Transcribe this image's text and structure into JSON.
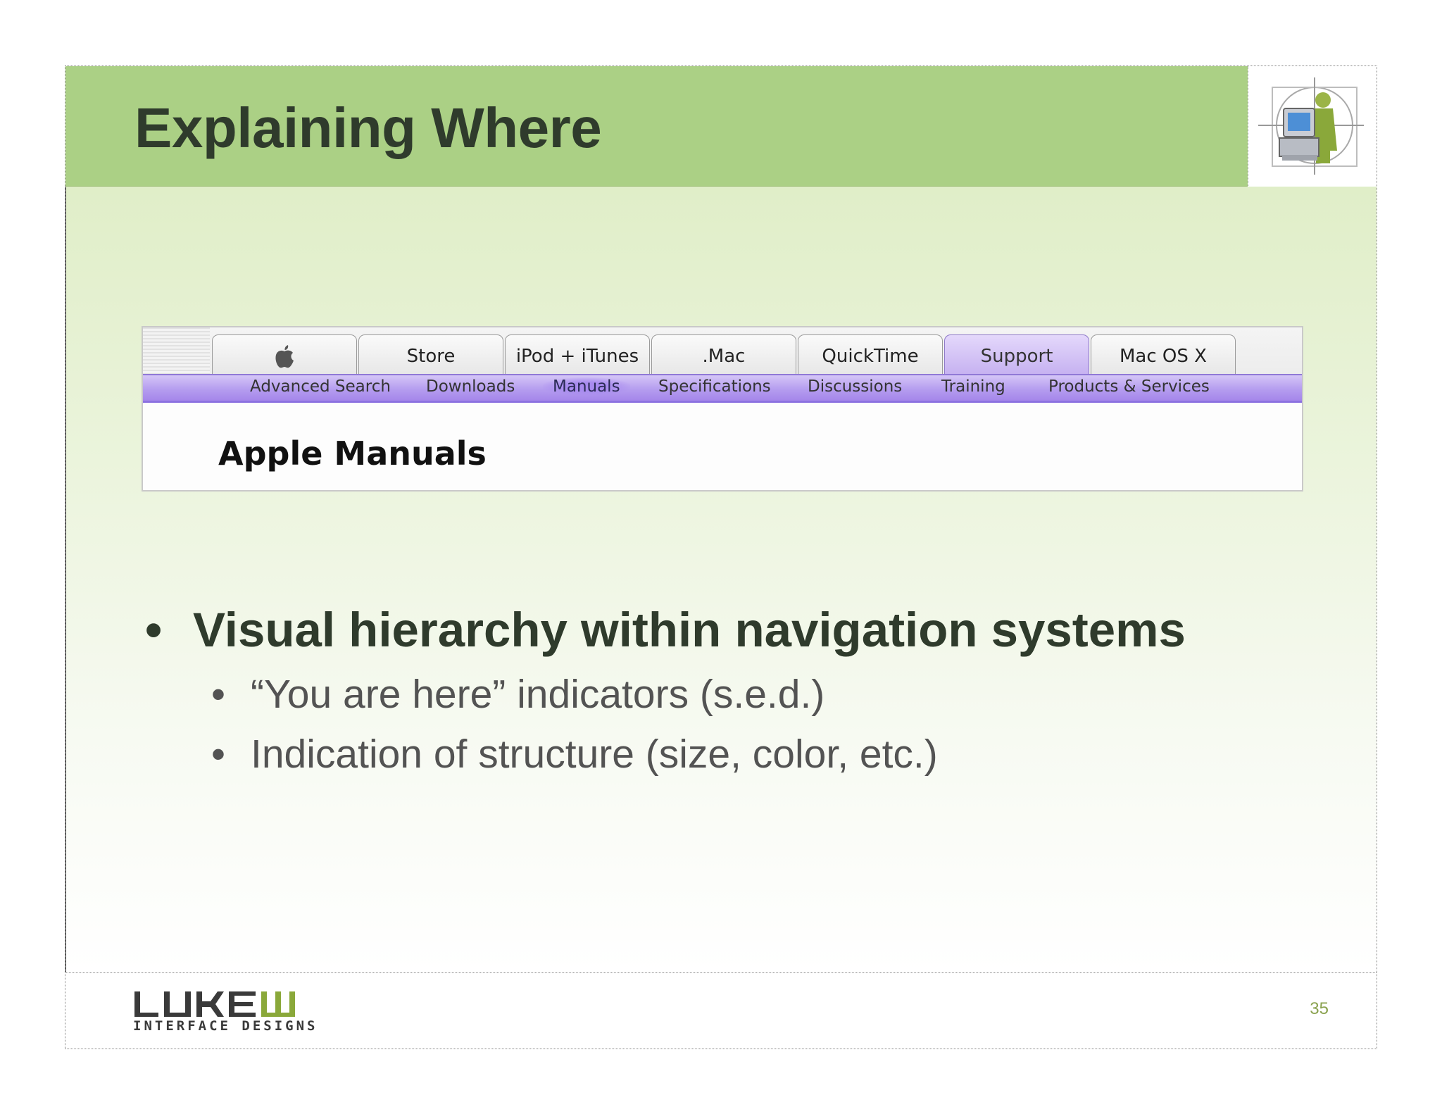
{
  "slide": {
    "title": "Explaining Where",
    "page_number": "35"
  },
  "screenshot": {
    "tabs": [
      {
        "label": "",
        "icon": "apple-logo-icon",
        "active": false
      },
      {
        "label": "Store",
        "active": false
      },
      {
        "label": "iPod + iTunes",
        "active": false
      },
      {
        "label": ".Mac",
        "active": false
      },
      {
        "label": "QuickTime",
        "active": false
      },
      {
        "label": "Support",
        "active": true
      },
      {
        "label": "Mac OS X",
        "active": false
      }
    ],
    "subnav": [
      {
        "label": "Advanced Search",
        "active": false
      },
      {
        "label": "Downloads",
        "active": false
      },
      {
        "label": "Manuals",
        "active": true
      },
      {
        "label": "Specifications",
        "active": false
      },
      {
        "label": "Discussions",
        "active": false
      },
      {
        "label": "Training",
        "active": false
      },
      {
        "label": "Products & Services",
        "active": false
      }
    ],
    "heading": "Apple Manuals",
    "active_color": "#c4aff0"
  },
  "bullets": {
    "main": "Visual hierarchy within navigation systems",
    "sub": [
      "“You are here” indicators (s.e.d.)",
      "Indication of structure (size, color, etc.)"
    ],
    "marker": "•"
  },
  "footer": {
    "brand_name": "LUKEW",
    "brand_tagline": "INTERFACE DESIGNS"
  },
  "colors": {
    "header_green": "#abd085",
    "title_text": "#2f3b2c",
    "page_number": "#8aa24f"
  }
}
